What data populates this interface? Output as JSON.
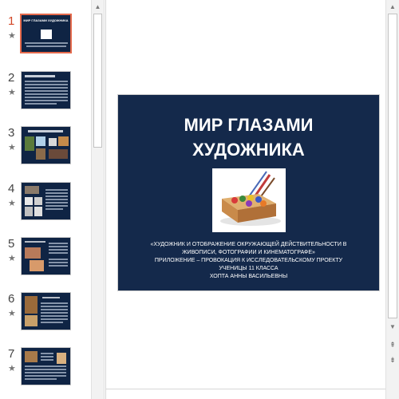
{
  "slides_panel": {
    "items": [
      {
        "number": "1",
        "star": "★",
        "active": true
      },
      {
        "number": "2",
        "star": "★",
        "active": false
      },
      {
        "number": "3",
        "star": "★",
        "active": false
      },
      {
        "number": "4",
        "star": "★",
        "active": false
      },
      {
        "number": "5",
        "star": "★",
        "active": false
      },
      {
        "number": "6",
        "star": "★",
        "active": false
      },
      {
        "number": "7",
        "star": "★",
        "active": false
      }
    ],
    "thumb_1_title": "МИР ГЛАЗАМИ ХУДОЖНИКА"
  },
  "scrollbar_left": {
    "up_arrow": "▲"
  },
  "scrollbar_right": {
    "up_arrow": "▲",
    "down_arrow": "▼",
    "prev_page": "⇞",
    "next_page": "⇟"
  },
  "slide": {
    "title_line1": "МИР ГЛАЗАМИ",
    "title_line2": "ХУДОЖНИКА",
    "subtitle_line1": "«ХУДОЖНИК И ОТОБРАЖЕНИЕ ОКРУЖАЮЩЕЙ ДЕЙСТВИТЕЛЬНОСТИ В",
    "subtitle_line2": "ЖИВОПИСИ, ФОТОГРАФИИ И КИНЕМАТОГРАФЕ»",
    "subtitle_line3": "ПРИЛОЖЕНИЕ – ПРОВОКАЦИЯ К ИССЛЕДОВАТЕЛЬСКОМУ ПРОЕКТУ",
    "subtitle_line4": "УЧЕНИЦЫ 11 КЛАССА",
    "subtitle_line5": "ХОПТА АННЫ ВАСИЛЬЕВНЫ",
    "picture_icon": "paint-box-icon"
  },
  "colors": {
    "slide_background": "#14294b",
    "active_accent": "#d24726",
    "text_light": "#ffffff"
  }
}
